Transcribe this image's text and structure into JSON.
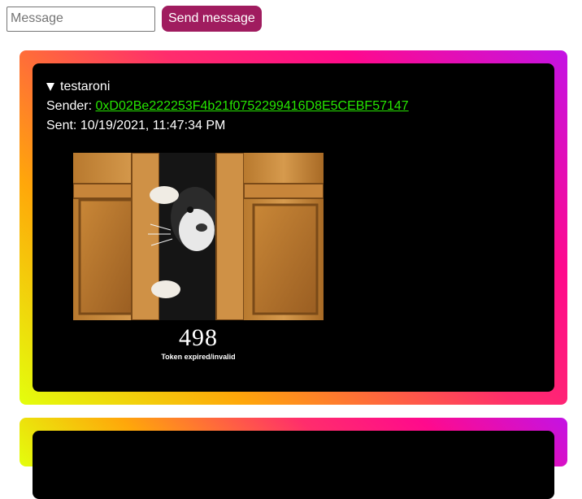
{
  "composer": {
    "placeholder": "Message",
    "send_label": "Send message",
    "send_color": "#a01c5f"
  },
  "messages": [
    {
      "summary": "testaroni",
      "sender_label": "Sender:",
      "sender_address": "0xD02Be222253F4b21f0752299416D8E5CEBF57147",
      "sent_label": "Sent:",
      "sent_time": "10/19/2021, 11:47:34 PM",
      "image": {
        "subject": "cat peeking through wooden door",
        "code": "498",
        "caption": "Token expired/invalid"
      }
    }
  ],
  "theme": {
    "card_background": "#000000",
    "link_color": "#26e600",
    "border_gradient": [
      "#e3ff0d",
      "#ffa70a",
      "#ff2d6c",
      "#ff0a8c",
      "#c313e5"
    ]
  }
}
